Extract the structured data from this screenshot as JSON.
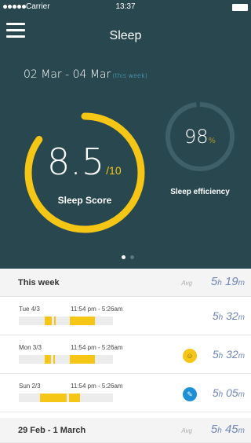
{
  "status_bar": {
    "carrier": "Carrier",
    "time": "13:37"
  },
  "header": {
    "title": "Sleep",
    "date_range": "02 Mar - 04 Mar",
    "range_tag": "(this week)"
  },
  "score": {
    "value": "8.5",
    "denominator": "/10",
    "label": "Sleep Score",
    "fraction": 0.85,
    "color": "#f6c617"
  },
  "efficiency": {
    "value": "98",
    "unit": "%",
    "label": "Sleep efficiency",
    "fraction": 0.98
  },
  "pager": {
    "active": 0,
    "count": 2
  },
  "this_week": {
    "title": "This week",
    "avg_label": "Avg",
    "avg_h": "5",
    "avg_h_unit": "h",
    "avg_m": "19",
    "avg_m_unit": "m",
    "rows": [
      {
        "day": "Tue 4/3",
        "time": "11:54 pm - 5:26am",
        "value_h": "5",
        "value_m": "32",
        "badge": ""
      },
      {
        "day": "Mon 3/3",
        "time": "11:54 pm - 5:26am",
        "value_h": "5",
        "value_m": "32",
        "badge": "smiley-face-icon"
      },
      {
        "day": "Sun 2/3",
        "time": "11:54 pm - 5:26am",
        "value_h": "5",
        "value_m": "05",
        "badge": "pen-note-icon"
      }
    ]
  },
  "prev_week": {
    "title": "29 Feb - 1 March",
    "avg_label": "Avg",
    "avg_h": "5",
    "avg_h_unit": "h",
    "avg_m": "45",
    "avg_m_unit": "m"
  },
  "colors": {
    "hero_bg": "#28474f",
    "accent": "#f6c617",
    "track": "#3f6068",
    "value_text": "#6e86b8",
    "tag": "#5bbfe8"
  }
}
